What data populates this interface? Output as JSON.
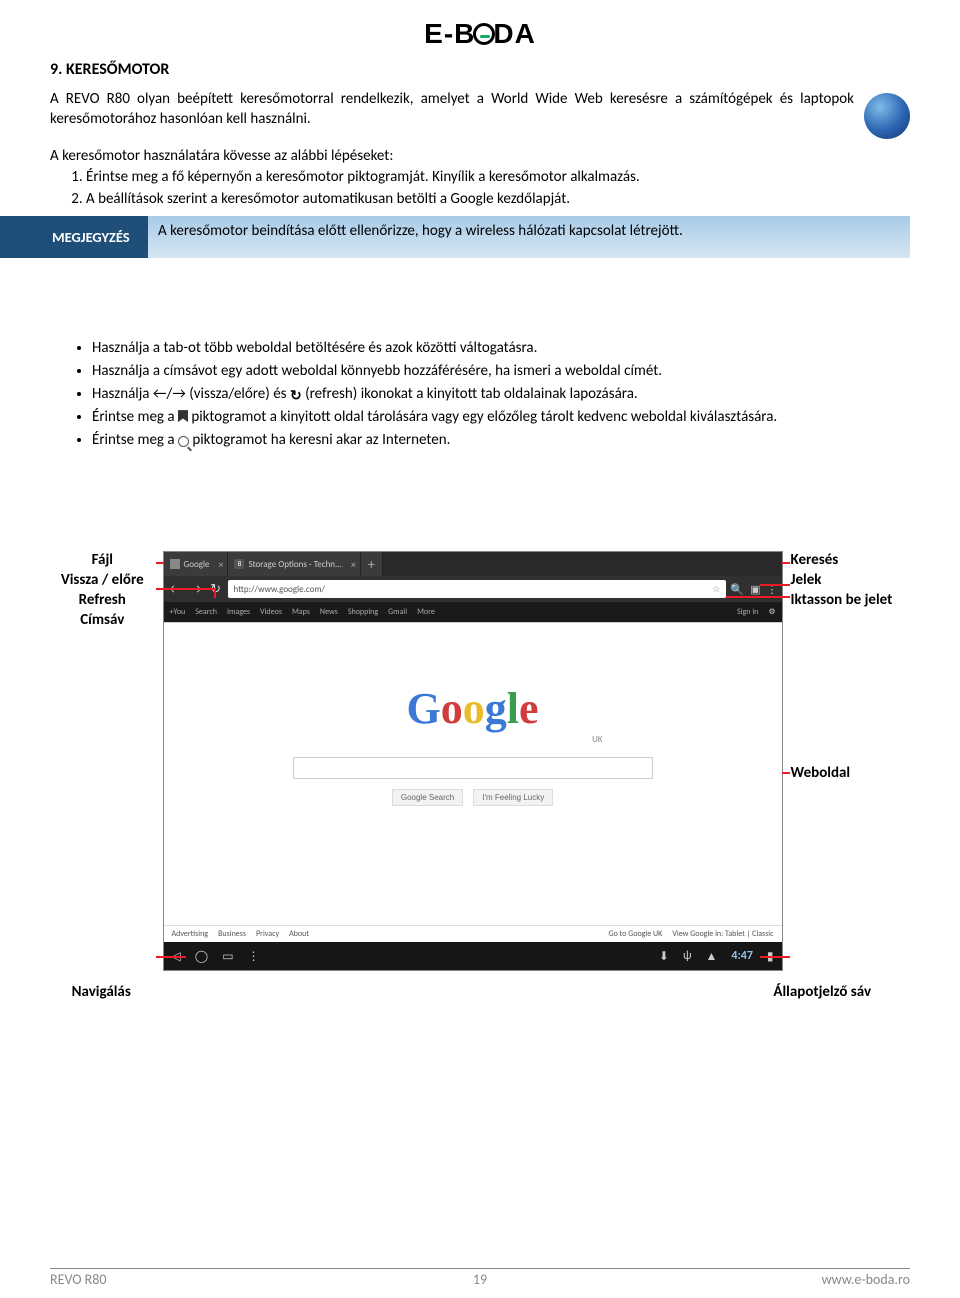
{
  "header_logo": {
    "left": "E-B",
    "right": "DA"
  },
  "section": {
    "title": "9. KERESŐMOTOR",
    "intro": "A REVO R80 olyan beépített keresőmotorral rendelkezik, amelyet a World Wide Web keresésre a számítógépek és laptopok keresőmotorához hasonlóan kell használni.",
    "steps_intro": "A keresőmotor használatára kövesse az alábbi lépéseket:",
    "steps": [
      "Érintse meg a fő képernyőn a keresőmotor piktogramját. Kinyílik a keresőmotor alkalmazás.",
      "A beállítások szerint a keresőmotor automatikusan betölti a Google kezdőlapját."
    ]
  },
  "note": {
    "label": "MEGJEGYZÉS",
    "text": "A keresőmotor beindítása előtt ellenőrizze, hogy a wireless hálózati kapcsolat létrejött."
  },
  "bullets": [
    "Használja a tab-ot több weboldal betöltésére és azok közötti váltogatásra.",
    "Használja a címsávot egy adott weboldal könnyebb hozzáférésére, ha ismeri a weboldal címét.",
    {
      "pre": "Használja ←/→ (vissza/előre) és ",
      "icon": "↻",
      "post": " (refresh) ikonokat a kinyitott tab oldalainak lapozására."
    },
    {
      "pre": "Érintse meg a ",
      "icon": "bookmark",
      "post": " piktogramot a kinyitott oldal tárolására vagy egy előzőleg tárolt kedvenc weboldal kiválasztására."
    },
    {
      "pre": "Érintse meg a ",
      "icon": "search",
      "post": " piktogramot ha keresni akar az Interneten."
    }
  ],
  "figure": {
    "left_labels": [
      "Fájl",
      "Vissza / előre",
      "Refresh",
      "Címsáv"
    ],
    "right_labels": [
      "Keresés",
      "Jelek",
      "Iktasson be jelet"
    ],
    "right_label_weboldal": "Weboldal",
    "bottom_left": "Navigálás",
    "bottom_right": "Állapotjelző sáv",
    "browser": {
      "tabs": [
        {
          "title": "Google"
        },
        {
          "title": "Storage Options - Techn..."
        }
      ],
      "tab_icon_label": "8",
      "url": "http://www.google.com/",
      "menu": [
        "+You",
        "Search",
        "Images",
        "Videos",
        "Maps",
        "News",
        "Shopping",
        "Gmail",
        "More"
      ],
      "signin": "Sign in",
      "google_sub": "UK",
      "btn_search": "Google Search",
      "btn_lucky": "I'm Feeling Lucky",
      "footer_left": [
        "Advertising",
        "Business",
        "Privacy",
        "About"
      ],
      "footer_right": [
        "Go to Google UK",
        "View Google in: Tablet | Classic"
      ],
      "time": "4:47"
    }
  },
  "footer": {
    "left": "REVO R80",
    "center": "19",
    "right": "www.e-boda.ro"
  }
}
